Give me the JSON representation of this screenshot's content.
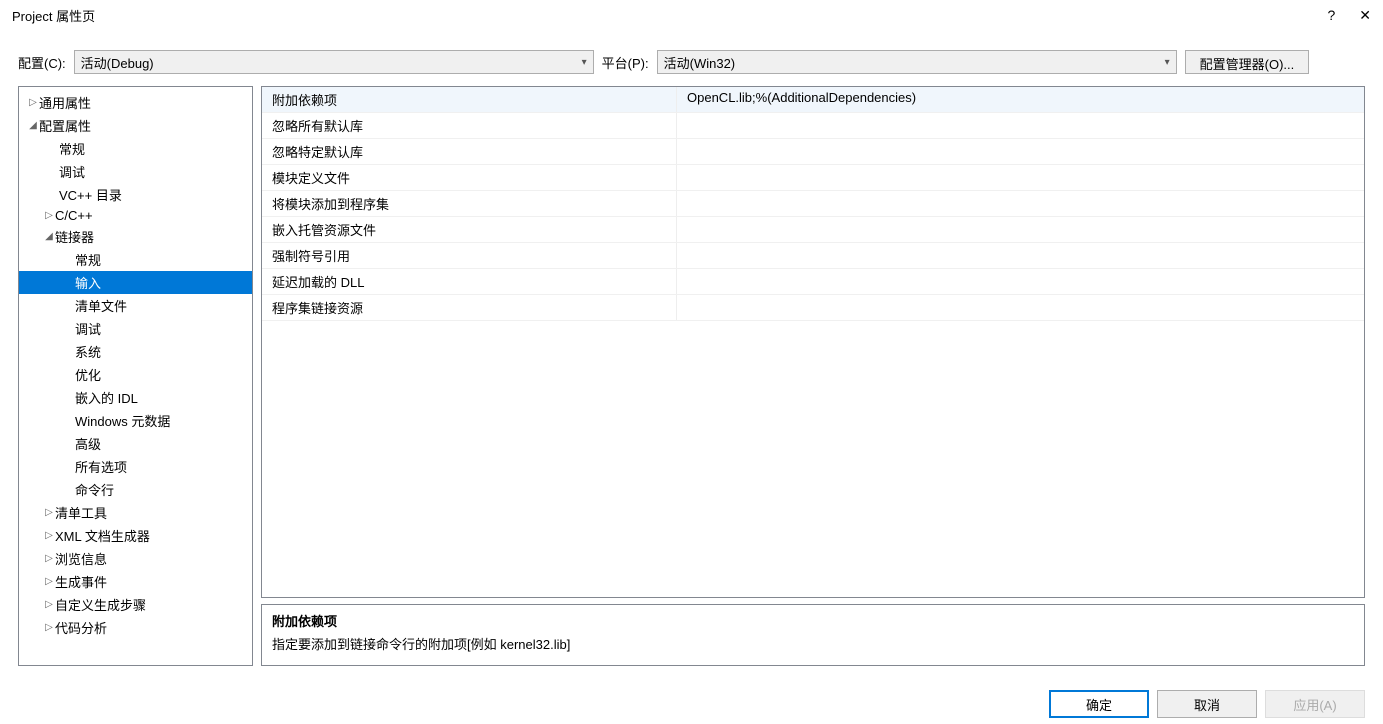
{
  "window": {
    "title": "Project 属性页",
    "help_icon": "?",
    "close_icon": "✕"
  },
  "config_row": {
    "config_label": "配置(C):",
    "config_value": "活动(Debug)",
    "platform_label": "平台(P):",
    "platform_value": "活动(Win32)",
    "manager_button": "配置管理器(O)..."
  },
  "tree": {
    "general_props": "通用属性",
    "config_props": "配置属性",
    "general": "常规",
    "debug": "调试",
    "vcdir": "VC++ 目录",
    "cpp": "C/C++",
    "linker": "链接器",
    "linker_general": "常规",
    "linker_input": "输入",
    "linker_manifest": "清单文件",
    "linker_debug": "调试",
    "linker_system": "系统",
    "linker_opt": "优化",
    "linker_idl": "嵌入的 IDL",
    "linker_winmeta": "Windows 元数据",
    "linker_advanced": "高级",
    "linker_all": "所有选项",
    "linker_cmd": "命令行",
    "manifest_tool": "清单工具",
    "xmldoc": "XML 文档生成器",
    "browse": "浏览信息",
    "build_events": "生成事件",
    "custom_build": "自定义生成步骤",
    "code_analysis": "代码分析"
  },
  "props": [
    {
      "name": "附加依赖项",
      "value": "OpenCL.lib;%(AdditionalDependencies)"
    },
    {
      "name": "忽略所有默认库",
      "value": ""
    },
    {
      "name": "忽略特定默认库",
      "value": ""
    },
    {
      "name": "模块定义文件",
      "value": ""
    },
    {
      "name": "将模块添加到程序集",
      "value": ""
    },
    {
      "name": "嵌入托管资源文件",
      "value": ""
    },
    {
      "name": "强制符号引用",
      "value": ""
    },
    {
      "name": "延迟加载的 DLL",
      "value": ""
    },
    {
      "name": "程序集链接资源",
      "value": ""
    }
  ],
  "description": {
    "title": "附加依赖项",
    "text": "指定要添加到链接命令行的附加项[例如 kernel32.lib]"
  },
  "buttons": {
    "ok": "确定",
    "cancel": "取消",
    "apply": "应用(A)"
  },
  "triangles": {
    "collapsed": "▷",
    "expanded": "◢"
  }
}
